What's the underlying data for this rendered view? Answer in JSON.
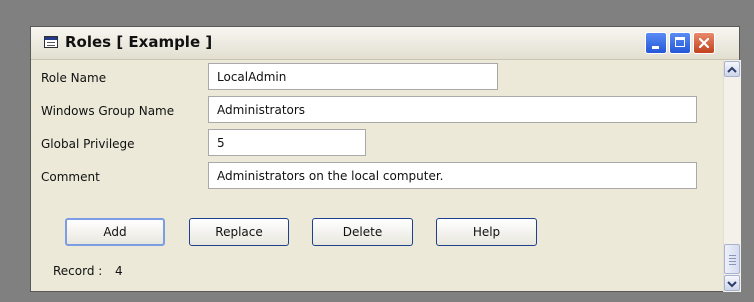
{
  "window": {
    "title": "Roles [ Example ]"
  },
  "form": {
    "role_name": {
      "label": "Role Name",
      "value": "LocalAdmin"
    },
    "windows_group_name": {
      "label": "Windows Group Name",
      "value": "Administrators"
    },
    "global_privilege": {
      "label": "Global Privilege",
      "value": "5"
    },
    "comment": {
      "label": "Comment",
      "value": "Administrators on the local computer."
    }
  },
  "buttons": {
    "add": "Add",
    "replace": "Replace",
    "delete": "Delete",
    "help": "Help"
  },
  "record": {
    "label": "Record :",
    "value": "4"
  },
  "icons": {
    "app": "form-window-icon",
    "minimize": "minimize-icon",
    "maximize": "maximize-icon",
    "close": "close-icon",
    "scroll_up": "chevron-up-icon",
    "scroll_down": "chevron-down-icon"
  },
  "colors": {
    "desktop": "#808080",
    "window_bg": "#ece9d8",
    "button_border": "#1f3f8f",
    "close_button": "#c0411f",
    "title_buttons": "#2457d8"
  }
}
